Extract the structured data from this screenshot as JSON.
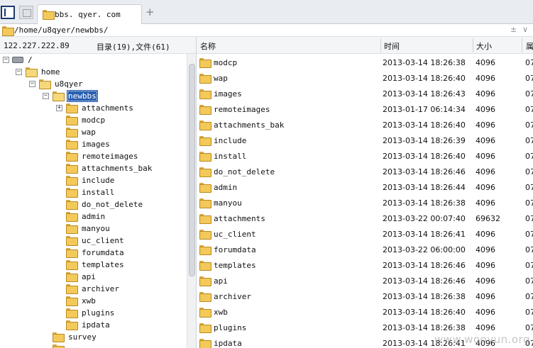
{
  "tab": {
    "title": "bbs. qyer. com",
    "new_tab": "+"
  },
  "pathbar": {
    "path": "/home/u8qyer/newbbs/",
    "ctrl_a": "±",
    "ctrl_b": "∨"
  },
  "left": {
    "ip": "122.227.222.89",
    "counts": "目录(19),文件(61)"
  },
  "tree": {
    "root": "/",
    "home": "home",
    "u8qyer": "u8qyer",
    "newbbs": "newbbs",
    "children": [
      "attachments",
      "modcp",
      "wap",
      "images",
      "remoteimages",
      "attachments_bak",
      "include",
      "install",
      "do_not_delete",
      "admin",
      "manyou",
      "uc_client",
      "forumdata",
      "templates",
      "api",
      "archiver",
      "xwb",
      "plugins",
      "ipdata"
    ],
    "survey": "survey"
  },
  "columns": {
    "name": "名称",
    "time": "时间",
    "size": "大小",
    "extra": "属"
  },
  "rows": [
    {
      "name": "modcp",
      "time": "2013-03-14 18:26:38",
      "size": "4096",
      "extra": "07"
    },
    {
      "name": "wap",
      "time": "2013-03-14 18:26:40",
      "size": "4096",
      "extra": "07"
    },
    {
      "name": "images",
      "time": "2013-03-14 18:26:43",
      "size": "4096",
      "extra": "07"
    },
    {
      "name": "remoteimages",
      "time": "2013-01-17 06:14:34",
      "size": "4096",
      "extra": "07"
    },
    {
      "name": "attachments_bak",
      "time": "2013-03-14 18:26:40",
      "size": "4096",
      "extra": "07"
    },
    {
      "name": "include",
      "time": "2013-03-14 18:26:39",
      "size": "4096",
      "extra": "07"
    },
    {
      "name": "install",
      "time": "2013-03-14 18:26:40",
      "size": "4096",
      "extra": "07"
    },
    {
      "name": "do_not_delete",
      "time": "2013-03-14 18:26:46",
      "size": "4096",
      "extra": "07"
    },
    {
      "name": "admin",
      "time": "2013-03-14 18:26:44",
      "size": "4096",
      "extra": "07"
    },
    {
      "name": "manyou",
      "time": "2013-03-14 18:26:38",
      "size": "4096",
      "extra": "07"
    },
    {
      "name": "attachments",
      "time": "2013-03-22 00:07:40",
      "size": "69632",
      "extra": "07"
    },
    {
      "name": "uc_client",
      "time": "2013-03-14 18:26:41",
      "size": "4096",
      "extra": "07"
    },
    {
      "name": "forumdata",
      "time": "2013-03-22 06:00:00",
      "size": "4096",
      "extra": "07"
    },
    {
      "name": "templates",
      "time": "2013-03-14 18:26:46",
      "size": "4096",
      "extra": "07"
    },
    {
      "name": "api",
      "time": "2013-03-14 18:26:46",
      "size": "4096",
      "extra": "07"
    },
    {
      "name": "archiver",
      "time": "2013-03-14 18:26:38",
      "size": "4096",
      "extra": "07"
    },
    {
      "name": "xwb",
      "time": "2013-03-14 18:26:40",
      "size": "4096",
      "extra": "07"
    },
    {
      "name": "plugins",
      "time": "2013-03-14 18:26:38",
      "size": "4096",
      "extra": "07"
    },
    {
      "name": "ipdata",
      "time": "2013-03-14 18:26:41",
      "size": "4096",
      "extra": "07"
    }
  ],
  "watermark": "www.wooyun.org",
  "colors": {
    "selection": "#2a5fb0",
    "folder": "#f3c95a"
  }
}
